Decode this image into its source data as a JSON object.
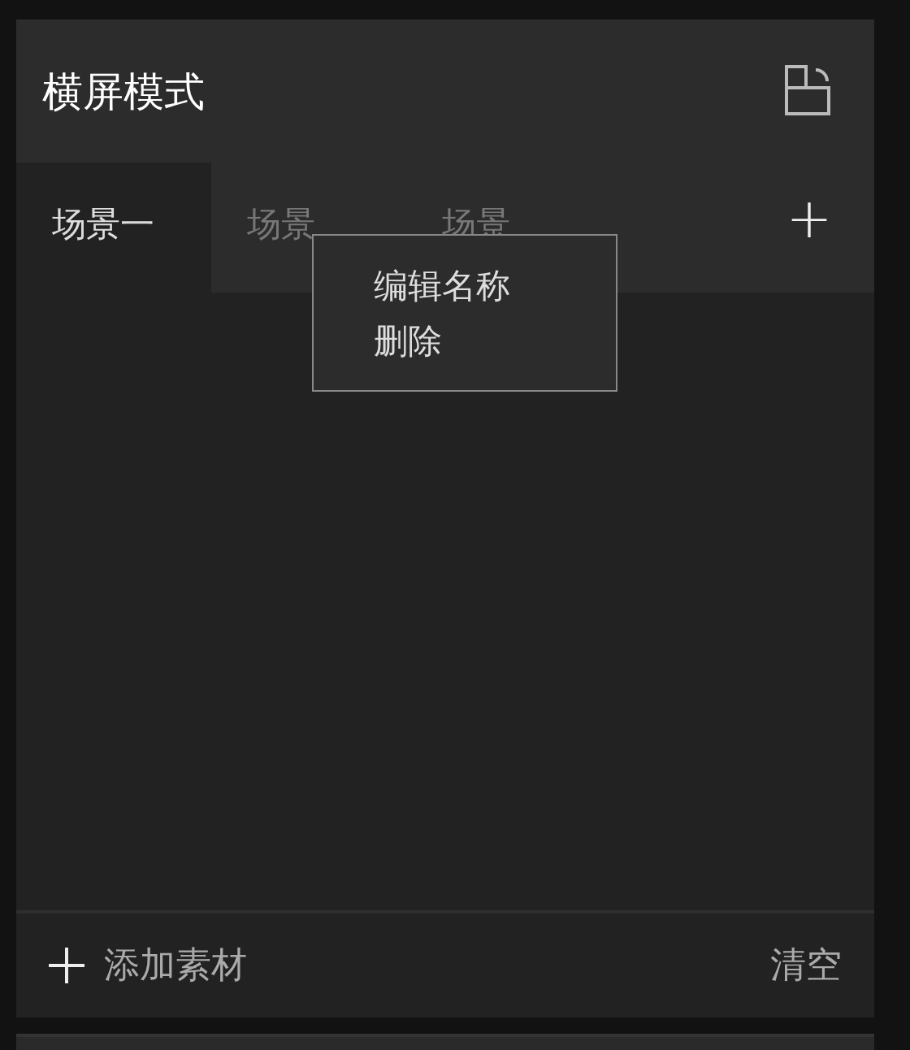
{
  "header": {
    "title": "横屏模式"
  },
  "tabs": [
    {
      "label": "场景一",
      "selected": true
    },
    {
      "label": "场景",
      "selected": false
    },
    {
      "label": "场景",
      "selected": false
    }
  ],
  "add_tab": {
    "label": "+"
  },
  "context_menu": {
    "items": [
      "编辑名称",
      "删除"
    ]
  },
  "footer": {
    "add_label": "添加素材",
    "clear_label": "清空"
  }
}
